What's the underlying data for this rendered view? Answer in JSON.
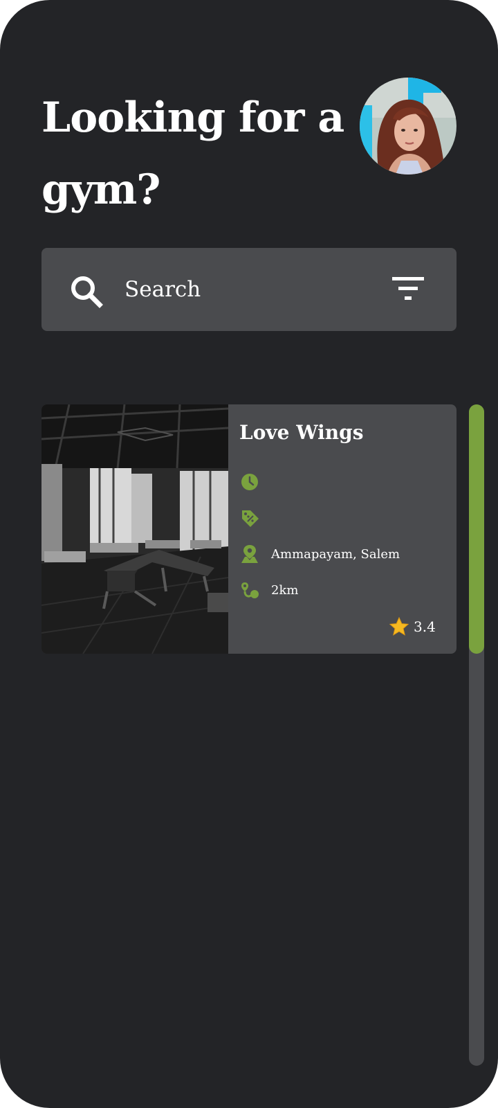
{
  "header": {
    "title": "Looking for a gym?"
  },
  "search": {
    "placeholder": "Search",
    "value": ""
  },
  "gyms": [
    {
      "name": "Love Wings",
      "hours": "",
      "offer": "",
      "location": "Ammapayam, Salem",
      "distance": "2km",
      "rating": "3.4"
    }
  ],
  "colors": {
    "background": "#232427",
    "surface": "#4a4b4e",
    "accent": "#7aa23e",
    "star": "#f5b921"
  },
  "icons": {
    "search": "search-icon",
    "filter": "filter-icon",
    "hours": "clock-icon",
    "offer": "discount-tag-icon",
    "location": "map-pin-icon",
    "distance": "route-icon",
    "rating": "star-icon"
  }
}
